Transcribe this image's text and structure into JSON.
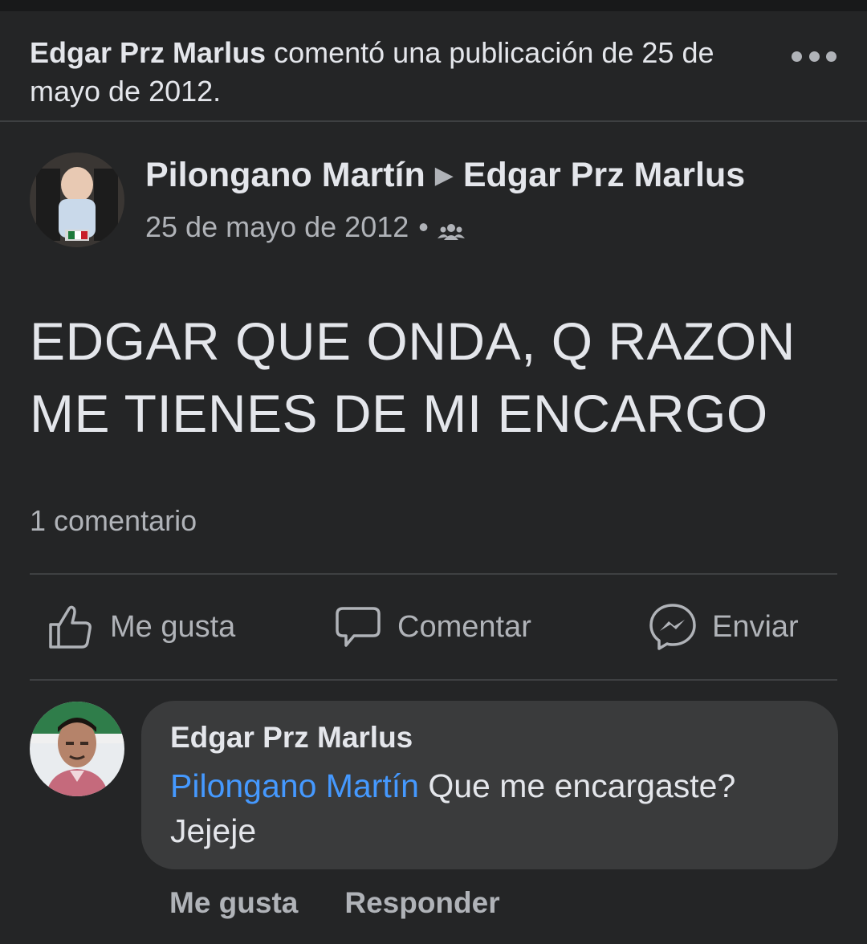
{
  "activity": {
    "actor": "Edgar Prz Marlus",
    "text": " comentó una publicación de 25 de mayo de 2012."
  },
  "post": {
    "author": "Pilongano Martín",
    "arrow": "▶",
    "target": "Edgar Prz Marlus",
    "date": "25 de mayo de 2012",
    "separator": "•",
    "audience_icon": "friends-icon",
    "body": "EDGAR QUE ONDA, Q RAZON ME TIENES DE MI ENCARGO",
    "comment_count": "1 comentario"
  },
  "actions": {
    "like": "Me gusta",
    "comment": "Comentar",
    "send": "Enviar"
  },
  "comment": {
    "author": "Edgar Prz Marlus",
    "mention": "Pilongano Martín",
    "text": " Que me encargaste? Jejeje",
    "like": "Me gusta",
    "reply": "Responder"
  },
  "colors": {
    "background": "#242526",
    "bubble": "#3a3b3c",
    "mention": "#4599ff",
    "secondary_text": "#b0b3b8"
  }
}
